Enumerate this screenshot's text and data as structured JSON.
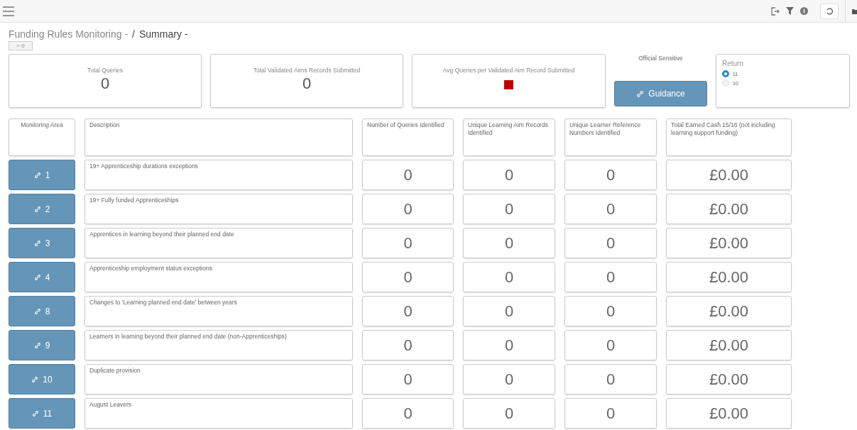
{
  "breadcrumb": {
    "parent": "Funding Rules Monitoring -",
    "separator": "/",
    "current": "Summary -"
  },
  "filter_chip": "= 0",
  "stats": [
    {
      "label": "Total Queries",
      "value": "0"
    },
    {
      "label": "Total Validated Aims Records Submitted",
      "value": "0"
    },
    {
      "label": "Avg Queries per Validated Aim Record Submitted",
      "color": "#c00000"
    }
  ],
  "classification": "Official Sensitive",
  "guidance_button": "Guidance",
  "return": {
    "title": "Return",
    "options": [
      {
        "label": "11",
        "selected": true
      },
      {
        "label": "10",
        "selected": false
      }
    ]
  },
  "table": {
    "columns": [
      "Monitoring Area",
      "Description",
      "Number of Queries Identified",
      "Unique Learning Aim Records Identified",
      "Unique Learner Reference Numbers Identified",
      "Total Earned Cash 15/16 (not including learning support funding)"
    ],
    "rows": [
      {
        "area": "1",
        "description": "19+ Apprenticeship durations exceptions",
        "queries": "0",
        "aims": "0",
        "learners": "0",
        "cash": "£0.00"
      },
      {
        "area": "2",
        "description": "19+ Fully funded Apprenticeships",
        "queries": "0",
        "aims": "0",
        "learners": "0",
        "cash": "£0.00"
      },
      {
        "area": "3",
        "description": "Apprentices in learning beyond their planned end date",
        "queries": "0",
        "aims": "0",
        "learners": "0",
        "cash": "£0.00"
      },
      {
        "area": "4",
        "description": "Apprenticeship employment status exceptions",
        "queries": "0",
        "aims": "0",
        "learners": "0",
        "cash": "£0.00"
      },
      {
        "area": "8",
        "description": "Changes to 'Learning planned end date' between years",
        "queries": "0",
        "aims": "0",
        "learners": "0",
        "cash": "£0.00"
      },
      {
        "area": "9",
        "description": "Learners in learning beyond their planned end date (non-Apprenticeships)",
        "queries": "0",
        "aims": "0",
        "learners": "0",
        "cash": "£0.00"
      },
      {
        "area": "10",
        "description": "Duplicate provision",
        "queries": "0",
        "aims": "0",
        "learners": "0",
        "cash": "£0.00"
      },
      {
        "area": "11",
        "description": "August Leavers",
        "queries": "0",
        "aims": "0",
        "learners": "0",
        "cash": "£0.00"
      }
    ]
  }
}
